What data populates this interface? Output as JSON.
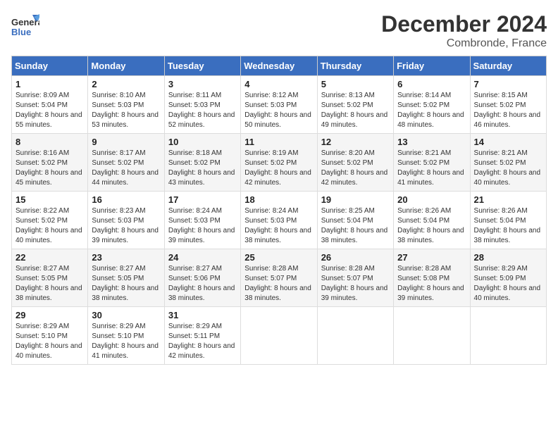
{
  "header": {
    "logo_text": "General Blue",
    "month_title": "December 2024",
    "location": "Combronde, France"
  },
  "weekdays": [
    "Sunday",
    "Monday",
    "Tuesday",
    "Wednesday",
    "Thursday",
    "Friday",
    "Saturday"
  ],
  "weeks": [
    [
      {
        "day": 1,
        "sunrise": "8:09 AM",
        "sunset": "5:04 PM",
        "daylight": "8 hours and 55 minutes."
      },
      {
        "day": 2,
        "sunrise": "8:10 AM",
        "sunset": "5:03 PM",
        "daylight": "8 hours and 53 minutes."
      },
      {
        "day": 3,
        "sunrise": "8:11 AM",
        "sunset": "5:03 PM",
        "daylight": "8 hours and 52 minutes."
      },
      {
        "day": 4,
        "sunrise": "8:12 AM",
        "sunset": "5:03 PM",
        "daylight": "8 hours and 50 minutes."
      },
      {
        "day": 5,
        "sunrise": "8:13 AM",
        "sunset": "5:02 PM",
        "daylight": "8 hours and 49 minutes."
      },
      {
        "day": 6,
        "sunrise": "8:14 AM",
        "sunset": "5:02 PM",
        "daylight": "8 hours and 48 minutes."
      },
      {
        "day": 7,
        "sunrise": "8:15 AM",
        "sunset": "5:02 PM",
        "daylight": "8 hours and 46 minutes."
      }
    ],
    [
      {
        "day": 8,
        "sunrise": "8:16 AM",
        "sunset": "5:02 PM",
        "daylight": "8 hours and 45 minutes."
      },
      {
        "day": 9,
        "sunrise": "8:17 AM",
        "sunset": "5:02 PM",
        "daylight": "8 hours and 44 minutes."
      },
      {
        "day": 10,
        "sunrise": "8:18 AM",
        "sunset": "5:02 PM",
        "daylight": "8 hours and 43 minutes."
      },
      {
        "day": 11,
        "sunrise": "8:19 AM",
        "sunset": "5:02 PM",
        "daylight": "8 hours and 42 minutes."
      },
      {
        "day": 12,
        "sunrise": "8:20 AM",
        "sunset": "5:02 PM",
        "daylight": "8 hours and 42 minutes."
      },
      {
        "day": 13,
        "sunrise": "8:21 AM",
        "sunset": "5:02 PM",
        "daylight": "8 hours and 41 minutes."
      },
      {
        "day": 14,
        "sunrise": "8:21 AM",
        "sunset": "5:02 PM",
        "daylight": "8 hours and 40 minutes."
      }
    ],
    [
      {
        "day": 15,
        "sunrise": "8:22 AM",
        "sunset": "5:02 PM",
        "daylight": "8 hours and 40 minutes."
      },
      {
        "day": 16,
        "sunrise": "8:23 AM",
        "sunset": "5:03 PM",
        "daylight": "8 hours and 39 minutes."
      },
      {
        "day": 17,
        "sunrise": "8:24 AM",
        "sunset": "5:03 PM",
        "daylight": "8 hours and 39 minutes."
      },
      {
        "day": 18,
        "sunrise": "8:24 AM",
        "sunset": "5:03 PM",
        "daylight": "8 hours and 38 minutes."
      },
      {
        "day": 19,
        "sunrise": "8:25 AM",
        "sunset": "5:04 PM",
        "daylight": "8 hours and 38 minutes."
      },
      {
        "day": 20,
        "sunrise": "8:26 AM",
        "sunset": "5:04 PM",
        "daylight": "8 hours and 38 minutes."
      },
      {
        "day": 21,
        "sunrise": "8:26 AM",
        "sunset": "5:04 PM",
        "daylight": "8 hours and 38 minutes."
      }
    ],
    [
      {
        "day": 22,
        "sunrise": "8:27 AM",
        "sunset": "5:05 PM",
        "daylight": "8 hours and 38 minutes."
      },
      {
        "day": 23,
        "sunrise": "8:27 AM",
        "sunset": "5:05 PM",
        "daylight": "8 hours and 38 minutes."
      },
      {
        "day": 24,
        "sunrise": "8:27 AM",
        "sunset": "5:06 PM",
        "daylight": "8 hours and 38 minutes."
      },
      {
        "day": 25,
        "sunrise": "8:28 AM",
        "sunset": "5:07 PM",
        "daylight": "8 hours and 38 minutes."
      },
      {
        "day": 26,
        "sunrise": "8:28 AM",
        "sunset": "5:07 PM",
        "daylight": "8 hours and 39 minutes."
      },
      {
        "day": 27,
        "sunrise": "8:28 AM",
        "sunset": "5:08 PM",
        "daylight": "8 hours and 39 minutes."
      },
      {
        "day": 28,
        "sunrise": "8:29 AM",
        "sunset": "5:09 PM",
        "daylight": "8 hours and 40 minutes."
      }
    ],
    [
      {
        "day": 29,
        "sunrise": "8:29 AM",
        "sunset": "5:10 PM",
        "daylight": "8 hours and 40 minutes."
      },
      {
        "day": 30,
        "sunrise": "8:29 AM",
        "sunset": "5:10 PM",
        "daylight": "8 hours and 41 minutes."
      },
      {
        "day": 31,
        "sunrise": "8:29 AM",
        "sunset": "5:11 PM",
        "daylight": "8 hours and 42 minutes."
      },
      null,
      null,
      null,
      null
    ]
  ]
}
